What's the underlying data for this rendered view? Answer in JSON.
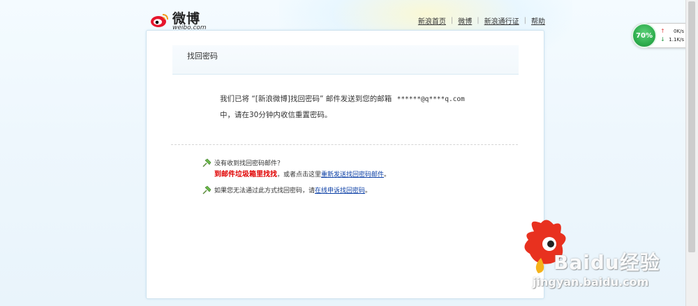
{
  "header": {
    "brand_cn": "微博",
    "brand_en": "weibo.com",
    "nav": [
      "新浪首页",
      "微博",
      "新浪通行证",
      "帮助"
    ]
  },
  "card": {
    "title": "找回密码",
    "message_line1": "我们已将 “[新浪微博]找回密码” 邮件发送到您的邮箱",
    "masked_email": "******@q****q.com",
    "message_line2": "中，请在30分钟内收信重置密码。"
  },
  "tips": {
    "not_received_q": "没有收到找回密码邮件？",
    "spam_hint": "到邮件垃圾箱里找找",
    "or_click": "，或者点击这里",
    "resend_link": "重新发送找回密码邮件",
    "period": "。",
    "alt_text": "如果您无法通过此方式找回密码，请",
    "appeal_link": "在线申诉找回密码",
    "period2": "。"
  },
  "speed_widget": {
    "percent": "70%",
    "upload": "0K/s",
    "download": "1.1K/s"
  },
  "watermark": {
    "text": "Baidu经验",
    "url": "jingyan.baidu.com"
  },
  "colors": {
    "link": "#0a3ea5",
    "alert_red": "#e00000",
    "widget_green": "#2fae4e"
  }
}
